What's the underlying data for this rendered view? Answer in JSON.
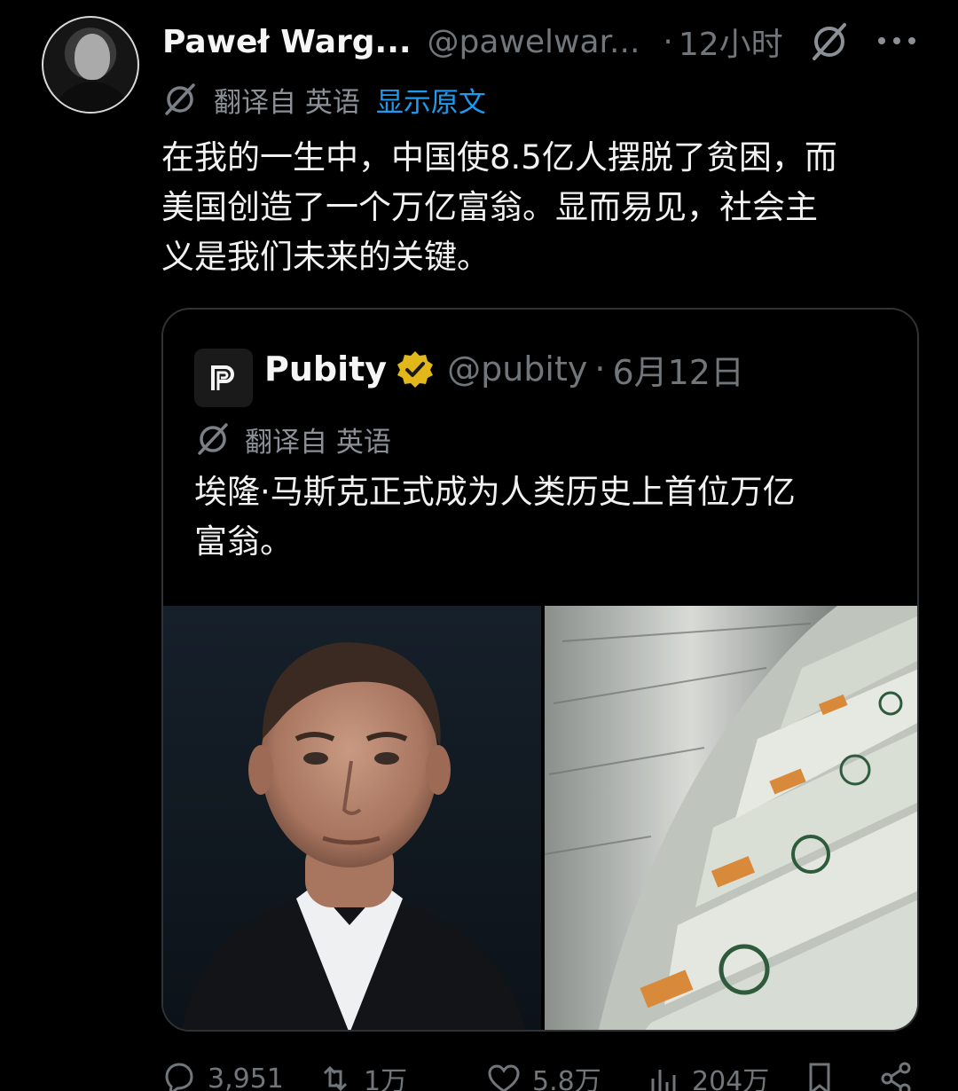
{
  "tweet": {
    "author_name": "Paweł Warg...",
    "author_handle": "@pawelwar...",
    "separator": "·",
    "time": "12小时",
    "translation": {
      "source": "翻译自 英语",
      "show_original": "显示原文"
    },
    "text_lines": [
      "在我的一生中，中国使8.5亿人摆脱了贫困，而",
      "美国创造了一个万亿富翁。显而易见，社会主",
      "义是我们未来的关键。"
    ]
  },
  "quote": {
    "author_name": "Pubity",
    "author_handle": "@pubity",
    "separator": "·",
    "date": "6月12日",
    "translation": {
      "source": "翻译自 英语"
    },
    "text_lines": [
      "埃隆·马斯克正式成为人类历史上首位万亿",
      "富翁。"
    ],
    "media": [
      "elon-musk-photo",
      "dollar-bills-printing-photo"
    ]
  },
  "actions": {
    "replies": "3,951",
    "retweets": "1万",
    "likes": "5.8万",
    "views": "204万"
  },
  "icons": [
    "grok-icon",
    "more-icon",
    "translate-icon",
    "verified-badge-icon",
    "reply-icon",
    "retweet-icon",
    "like-icon",
    "views-icon",
    "bookmark-icon",
    "share-icon"
  ],
  "colors": {
    "background": "#000000",
    "link": "#1d9bf0",
    "muted": "#71767b",
    "verified": "#e2b719"
  }
}
